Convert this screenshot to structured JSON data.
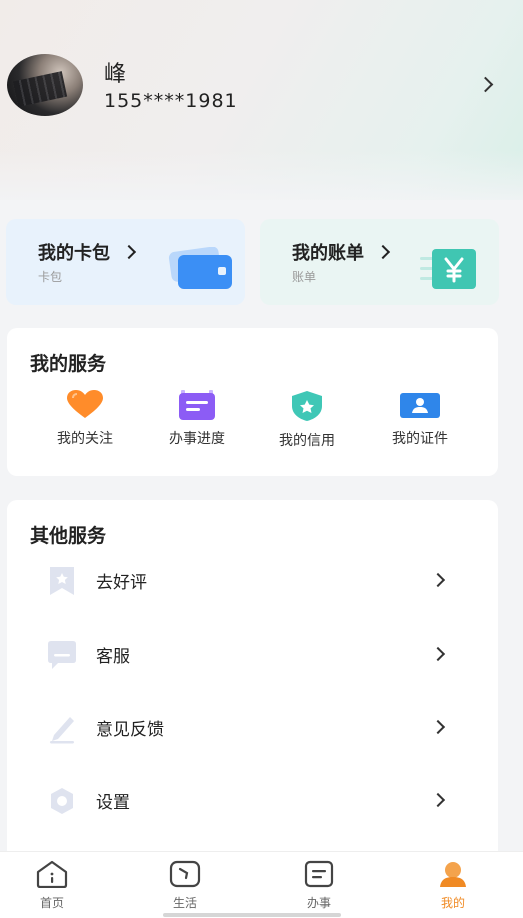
{
  "profile": {
    "name": "峰",
    "phone": "155****1981"
  },
  "cards": [
    {
      "title": "我的卡包",
      "subtitle": "卡包"
    },
    {
      "title": "我的账单",
      "subtitle": "账单"
    }
  ],
  "services": {
    "title": "我的服务",
    "items": [
      {
        "label": "我的关注",
        "icon": "heart-icon"
      },
      {
        "label": "办事进度",
        "icon": "progress-icon"
      },
      {
        "label": "我的信用",
        "icon": "shield-star-icon"
      },
      {
        "label": "我的证件",
        "icon": "id-card-icon"
      }
    ]
  },
  "other": {
    "title": "其他服务",
    "items": [
      {
        "label": "去好评",
        "icon": "bookmark-star-icon"
      },
      {
        "label": "客服",
        "icon": "chat-bubble-icon"
      },
      {
        "label": "意见反馈",
        "icon": "pencil-icon"
      },
      {
        "label": "设置",
        "icon": "gear-icon"
      }
    ]
  },
  "tabs": [
    {
      "label": "首页",
      "icon": "home-info-icon"
    },
    {
      "label": "生活",
      "icon": "life-icon"
    },
    {
      "label": "办事",
      "icon": "doc-icon"
    },
    {
      "label": "我的",
      "icon": "user-icon",
      "active": true
    }
  ],
  "colors": {
    "accent": "#f08a24",
    "wallet_blue": "#3b8ff5",
    "bill_teal": "#40c6b2"
  }
}
